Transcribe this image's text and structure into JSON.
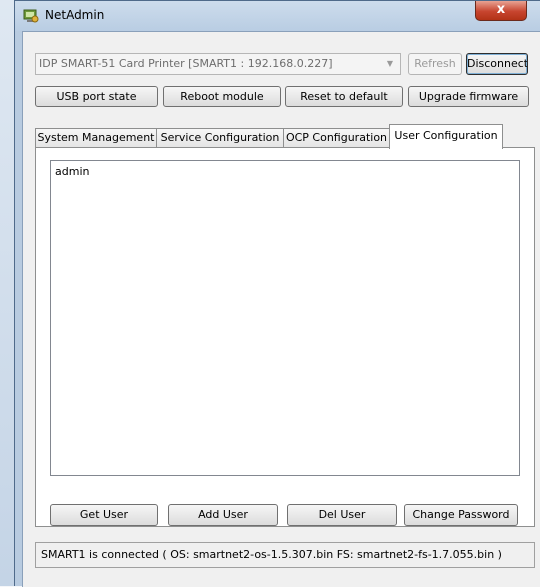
{
  "window": {
    "title": "NetAdmin",
    "close_label": "x"
  },
  "device": {
    "selected": "IDP SMART-51 Card Printer  [SMART1 : 192.168.0.227]",
    "refresh_label": "Refresh",
    "disconnect_label": "Disconnect"
  },
  "actions": {
    "usb_port_state": "USB port state",
    "reboot_module": "Reboot module",
    "reset_to_default": "Reset to default",
    "upgrade_firmware": "Upgrade firmware"
  },
  "tabs": [
    {
      "label": "System Management",
      "active": false
    },
    {
      "label": "Service Configuration",
      "active": false
    },
    {
      "label": "OCP Configuration",
      "active": false
    },
    {
      "label": "User Configuration",
      "active": true
    }
  ],
  "users": [
    "admin"
  ],
  "user_buttons": {
    "get_user": "Get User",
    "add_user": "Add User",
    "del_user": "Del User",
    "change_password": "Change Password"
  },
  "status": "SMART1 is connected ( OS: smartnet2-os-1.5.307.bin  FS: smartnet2-fs-1.7.055.bin )",
  "colors": {
    "accent": "#b8cbe0",
    "close": "#c7452f"
  },
  "icons": {
    "app": "network-admin-icon",
    "close": "close-icon",
    "dropdown": "chevron-down-icon"
  }
}
